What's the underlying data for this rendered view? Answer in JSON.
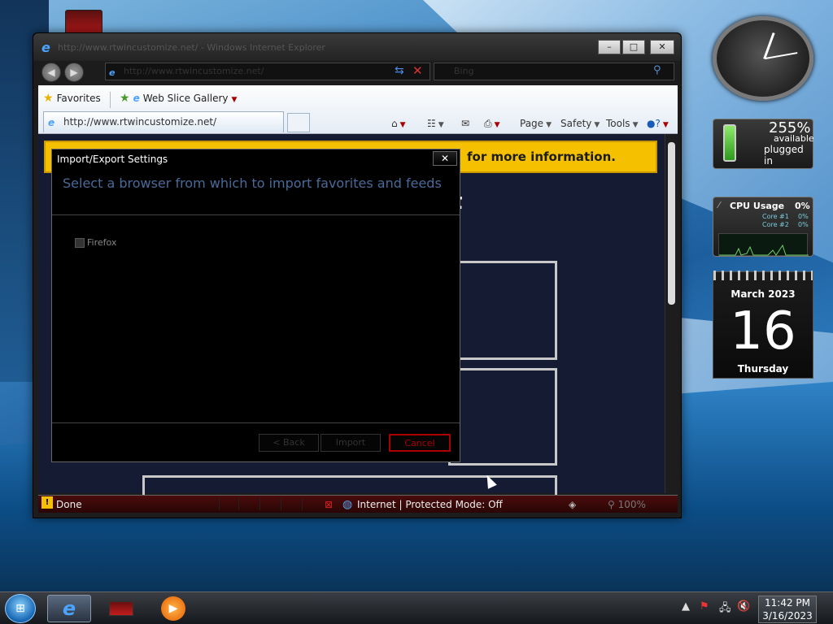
{
  "window": {
    "title": "http://www.rtwincustomize.net/ - Windows Internet Explorer",
    "address": "http://www.rtwincustomize.net/",
    "search_placeholder": "Bing"
  },
  "toolbar": {
    "favorites_label": "Favorites",
    "web_slice_label": "Web Slice Gallery",
    "tab_title": "http://www.rtwincustomize.net/",
    "page_label": "Page",
    "safety_label": "Safety",
    "tools_label": "Tools"
  },
  "content": {
    "banner_text": "for more information.",
    "heading_fragment": "t"
  },
  "dialog": {
    "title": "Import/Export Settings",
    "heading": "Select a browser from which to import favorites and feeds",
    "options": [
      {
        "label": "Firefox",
        "checked": false
      }
    ],
    "back_label": "< Back",
    "import_label": "Import",
    "cancel_label": "Cancel"
  },
  "statusbar": {
    "status": "Done",
    "zone": "Internet | Protected Mode: Off",
    "zoom": "100%"
  },
  "gadgets": {
    "battery": {
      "percent": "255%",
      "available": "available",
      "status": "plugged in"
    },
    "cpu": {
      "title": "CPU Usage",
      "value": "0%",
      "core1_label": "Core #1",
      "core1_value": "0%",
      "core2_label": "Core #2",
      "core2_value": "0%"
    },
    "calendar": {
      "month": "March 2023",
      "day": "16",
      "weekday": "Thursday"
    }
  },
  "taskbar": {
    "time": "11:42 PM",
    "date": "3/16/2023"
  },
  "colors": {
    "banner": "#f5c000",
    "cancel_border": "#aa0000",
    "dialog_heading": "#4a6a99"
  }
}
